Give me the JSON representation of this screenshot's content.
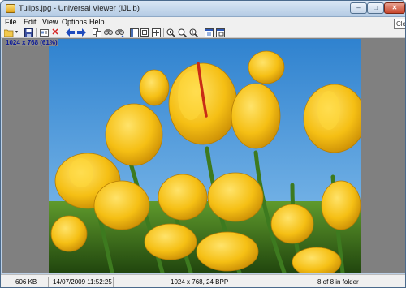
{
  "window": {
    "title": "Tulips.jpg - Universal Viewer (IJLib)",
    "minimize_glyph": "–",
    "maximize_glyph": "□",
    "close_glyph": "✕",
    "close_tooltip": "Close"
  },
  "menu": [
    "File",
    "Edit",
    "View",
    "Options",
    "Help"
  ],
  "toolbar": {
    "buttons": [
      "open-folder-icon",
      "save-icon",
      "properties-icon",
      "delete-icon",
      "back-arrow-icon",
      "forward-arrow-icon",
      "copy-icon",
      "find-icon",
      "find-next-icon",
      "panel-icon",
      "fit-window-icon",
      "original-size-icon",
      "zoom-in-icon",
      "zoom-out-icon",
      "zoom-original-icon",
      "fullscreen-icon",
      "window-icon"
    ]
  },
  "image": {
    "resolution_label": "1024 x 768 (61%)",
    "sky_color": "#4a94d4",
    "petal_color": "#f2bb12",
    "stem_color": "#3d7a1f"
  },
  "status": {
    "size": "606 KB",
    "datetime": "14/07/2009 11:52:25",
    "dimensions": "1024 x 768, 24 BPP",
    "folder_position": "8 of 8 in folder"
  }
}
